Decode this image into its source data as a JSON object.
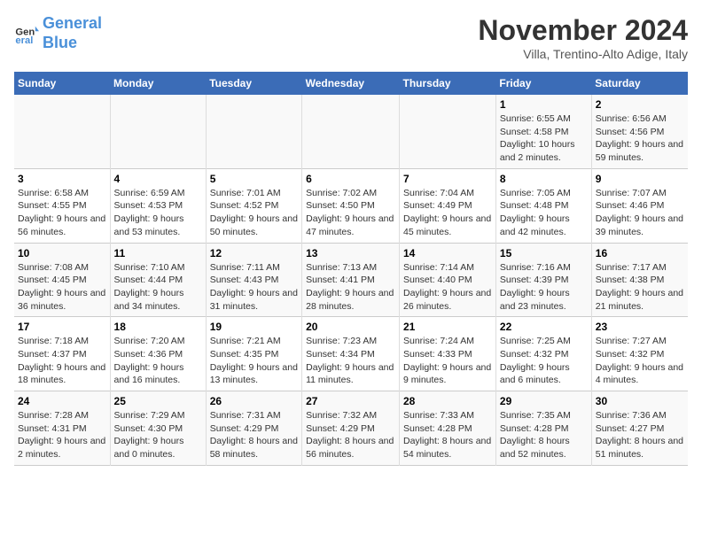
{
  "logo": {
    "line1": "General",
    "line2": "Blue"
  },
  "title": "November 2024",
  "subtitle": "Villa, Trentino-Alto Adige, Italy",
  "weekdays": [
    "Sunday",
    "Monday",
    "Tuesday",
    "Wednesday",
    "Thursday",
    "Friday",
    "Saturday"
  ],
  "weeks": [
    [
      {
        "day": "",
        "info": ""
      },
      {
        "day": "",
        "info": ""
      },
      {
        "day": "",
        "info": ""
      },
      {
        "day": "",
        "info": ""
      },
      {
        "day": "",
        "info": ""
      },
      {
        "day": "1",
        "info": "Sunrise: 6:55 AM\nSunset: 4:58 PM\nDaylight: 10 hours and 2 minutes."
      },
      {
        "day": "2",
        "info": "Sunrise: 6:56 AM\nSunset: 4:56 PM\nDaylight: 9 hours and 59 minutes."
      }
    ],
    [
      {
        "day": "3",
        "info": "Sunrise: 6:58 AM\nSunset: 4:55 PM\nDaylight: 9 hours and 56 minutes."
      },
      {
        "day": "4",
        "info": "Sunrise: 6:59 AM\nSunset: 4:53 PM\nDaylight: 9 hours and 53 minutes."
      },
      {
        "day": "5",
        "info": "Sunrise: 7:01 AM\nSunset: 4:52 PM\nDaylight: 9 hours and 50 minutes."
      },
      {
        "day": "6",
        "info": "Sunrise: 7:02 AM\nSunset: 4:50 PM\nDaylight: 9 hours and 47 minutes."
      },
      {
        "day": "7",
        "info": "Sunrise: 7:04 AM\nSunset: 4:49 PM\nDaylight: 9 hours and 45 minutes."
      },
      {
        "day": "8",
        "info": "Sunrise: 7:05 AM\nSunset: 4:48 PM\nDaylight: 9 hours and 42 minutes."
      },
      {
        "day": "9",
        "info": "Sunrise: 7:07 AM\nSunset: 4:46 PM\nDaylight: 9 hours and 39 minutes."
      }
    ],
    [
      {
        "day": "10",
        "info": "Sunrise: 7:08 AM\nSunset: 4:45 PM\nDaylight: 9 hours and 36 minutes."
      },
      {
        "day": "11",
        "info": "Sunrise: 7:10 AM\nSunset: 4:44 PM\nDaylight: 9 hours and 34 minutes."
      },
      {
        "day": "12",
        "info": "Sunrise: 7:11 AM\nSunset: 4:43 PM\nDaylight: 9 hours and 31 minutes."
      },
      {
        "day": "13",
        "info": "Sunrise: 7:13 AM\nSunset: 4:41 PM\nDaylight: 9 hours and 28 minutes."
      },
      {
        "day": "14",
        "info": "Sunrise: 7:14 AM\nSunset: 4:40 PM\nDaylight: 9 hours and 26 minutes."
      },
      {
        "day": "15",
        "info": "Sunrise: 7:16 AM\nSunset: 4:39 PM\nDaylight: 9 hours and 23 minutes."
      },
      {
        "day": "16",
        "info": "Sunrise: 7:17 AM\nSunset: 4:38 PM\nDaylight: 9 hours and 21 minutes."
      }
    ],
    [
      {
        "day": "17",
        "info": "Sunrise: 7:18 AM\nSunset: 4:37 PM\nDaylight: 9 hours and 18 minutes."
      },
      {
        "day": "18",
        "info": "Sunrise: 7:20 AM\nSunset: 4:36 PM\nDaylight: 9 hours and 16 minutes."
      },
      {
        "day": "19",
        "info": "Sunrise: 7:21 AM\nSunset: 4:35 PM\nDaylight: 9 hours and 13 minutes."
      },
      {
        "day": "20",
        "info": "Sunrise: 7:23 AM\nSunset: 4:34 PM\nDaylight: 9 hours and 11 minutes."
      },
      {
        "day": "21",
        "info": "Sunrise: 7:24 AM\nSunset: 4:33 PM\nDaylight: 9 hours and 9 minutes."
      },
      {
        "day": "22",
        "info": "Sunrise: 7:25 AM\nSunset: 4:32 PM\nDaylight: 9 hours and 6 minutes."
      },
      {
        "day": "23",
        "info": "Sunrise: 7:27 AM\nSunset: 4:32 PM\nDaylight: 9 hours and 4 minutes."
      }
    ],
    [
      {
        "day": "24",
        "info": "Sunrise: 7:28 AM\nSunset: 4:31 PM\nDaylight: 9 hours and 2 minutes."
      },
      {
        "day": "25",
        "info": "Sunrise: 7:29 AM\nSunset: 4:30 PM\nDaylight: 9 hours and 0 minutes."
      },
      {
        "day": "26",
        "info": "Sunrise: 7:31 AM\nSunset: 4:29 PM\nDaylight: 8 hours and 58 minutes."
      },
      {
        "day": "27",
        "info": "Sunrise: 7:32 AM\nSunset: 4:29 PM\nDaylight: 8 hours and 56 minutes."
      },
      {
        "day": "28",
        "info": "Sunrise: 7:33 AM\nSunset: 4:28 PM\nDaylight: 8 hours and 54 minutes."
      },
      {
        "day": "29",
        "info": "Sunrise: 7:35 AM\nSunset: 4:28 PM\nDaylight: 8 hours and 52 minutes."
      },
      {
        "day": "30",
        "info": "Sunrise: 7:36 AM\nSunset: 4:27 PM\nDaylight: 8 hours and 51 minutes."
      }
    ]
  ]
}
